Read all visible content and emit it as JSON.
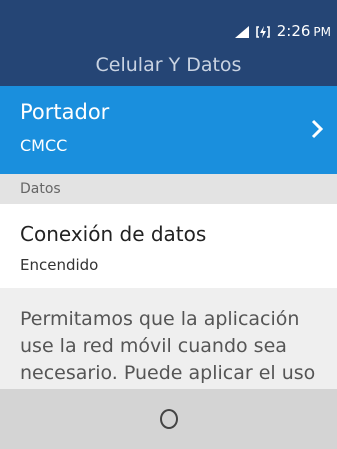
{
  "status_bar": {
    "time": "2:26",
    "ampm": "PM",
    "icons": [
      "signal-icon",
      "battery-charging-icon"
    ]
  },
  "header": {
    "title": "Celular Y Datos"
  },
  "carrier": {
    "label": "Portador",
    "value": "CMCC",
    "icon": "chevron-right-icon",
    "highlight_color": "#1a8fdd"
  },
  "data_section": {
    "header": "Datos",
    "item": {
      "label": "Conexión de datos",
      "value": "Encendido"
    }
  },
  "description": {
    "text": "Permitamos que la aplicación use la red móvil cuando sea necesario. Puede aplicar el uso de"
  },
  "softkeys": {
    "center_icon": "center-circle-icon"
  },
  "colors": {
    "header_bg": "#254575",
    "accent": "#1a8fdd",
    "softkey_bg": "#d4d4d4"
  }
}
